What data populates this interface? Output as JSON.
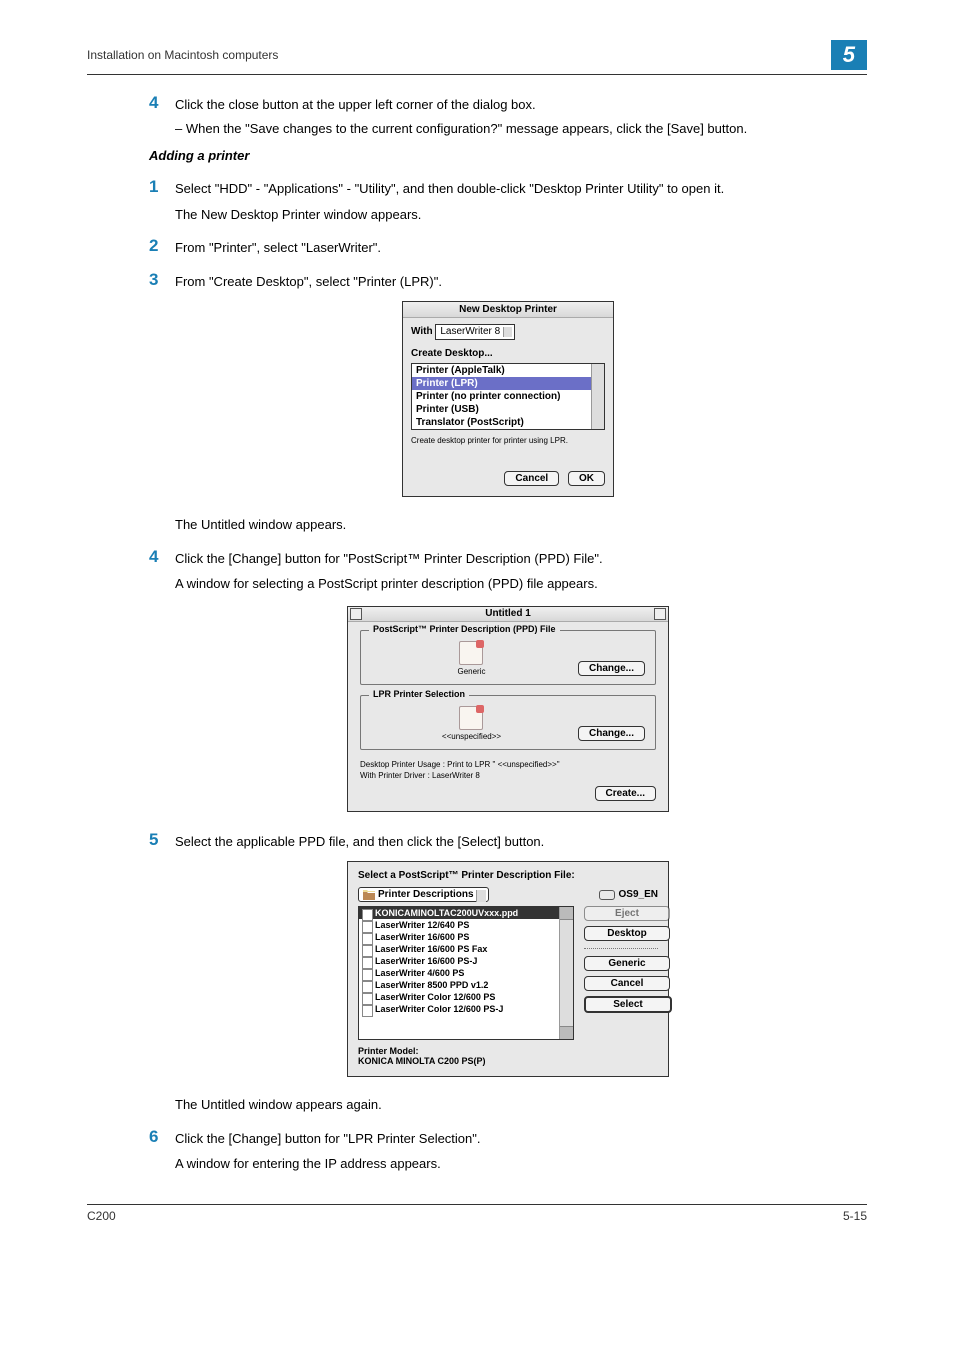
{
  "header": {
    "left": "Installation on Macintosh computers",
    "chapter": "5"
  },
  "s4pre": {
    "num": "4",
    "body": "Click the close button at the upper left corner of the dialog box.",
    "sub": "–   When the \"Save changes to the current configuration?\" message appears, click the [Save] button."
  },
  "subheading": "Adding a printer",
  "s1": {
    "num": "1",
    "body": "Select \"HDD\" - \"Applications\" - \"Utility\", and then double-click \"Desktop Printer Utility\" to open it.",
    "after": "The New Desktop Printer window appears."
  },
  "s2": {
    "num": "2",
    "body": "From \"Printer\", select \"LaserWriter\"."
  },
  "s3": {
    "num": "3",
    "body": "From \"Create Desktop\", select \"Printer (LPR)\"."
  },
  "dlg1": {
    "title": "New Desktop Printer",
    "with_label": "With",
    "with_value": "LaserWriter 8",
    "create_label": "Create Desktop...",
    "options": [
      "Printer (AppleTalk)",
      "Printer (LPR)",
      "Printer (no printer connection)",
      "Printer (USB)",
      "Translator (PostScript)"
    ],
    "selected_index": 1,
    "hint": "Create desktop printer for printer using LPR.",
    "cancel": "Cancel",
    "ok": "OK"
  },
  "after_dlg1": "The Untitled window appears.",
  "s4": {
    "num": "4",
    "body": "Click the [Change] button for \"PostScript™ Printer Description (PPD) File\".",
    "after": "A window for selecting a PostScript printer description (PPD) file appears."
  },
  "dlg2": {
    "title": "Untitled 1",
    "group1": {
      "legend": "PostScript™ Printer Description (PPD) File",
      "value": "Generic",
      "change": "Change..."
    },
    "group2": {
      "legend": "LPR Printer Selection",
      "value": "<<unspecified>>",
      "change": "Change..."
    },
    "desc1": "Desktop Printer Usage : Print to LPR \" <<unspecified>>\"",
    "desc2": "With Printer Driver : LaserWriter 8",
    "create": "Create..."
  },
  "s5": {
    "num": "5",
    "body": "Select the applicable PPD file, and then click the [Select] button."
  },
  "dlg3": {
    "head": "Select a PostScript™ Printer Description File:",
    "location": "Printer Descriptions",
    "drive": "OS9_EN",
    "files": [
      "KONICAMINOLTAC200UVxxx.ppd",
      "LaserWriter 12/640 PS",
      "LaserWriter 16/600 PS",
      "LaserWriter 16/600 PS Fax",
      "LaserWriter 16/600 PS-J",
      "LaserWriter 4/600 PS",
      "LaserWriter 8500 PPD v1.2",
      "LaserWriter Color 12/600 PS",
      "LaserWriter Color 12/600 PS-J"
    ],
    "selected_index": 0,
    "buttons": {
      "eject": "Eject",
      "desktop": "Desktop",
      "generic": "Generic",
      "cancel": "Cancel",
      "select": "Select"
    },
    "pm_label": "Printer Model:",
    "pm_value": "KONICA MINOLTA C200 PS(P)"
  },
  "after_dlg3": "The Untitled window appears again.",
  "s6": {
    "num": "6",
    "body": "Click the [Change] button for \"LPR Printer Selection\".",
    "after": "A window for entering the IP address appears."
  },
  "footer": {
    "left": "C200",
    "right": "5-15"
  }
}
